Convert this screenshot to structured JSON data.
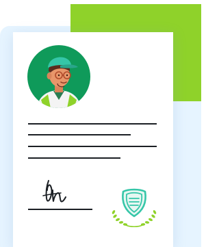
{
  "colors": {
    "accent_green": "#8fd22a",
    "panel_blue": "#e6f4ff",
    "paper": "#ffffff",
    "ink": "#1b1f24",
    "avatar_bg": "#0f9a5a",
    "badge_teal": "#35c6a8"
  },
  "icons": {
    "avatar": "person-avatar-icon",
    "signature": "signature-icon",
    "badge": "certificate-badge-icon"
  }
}
